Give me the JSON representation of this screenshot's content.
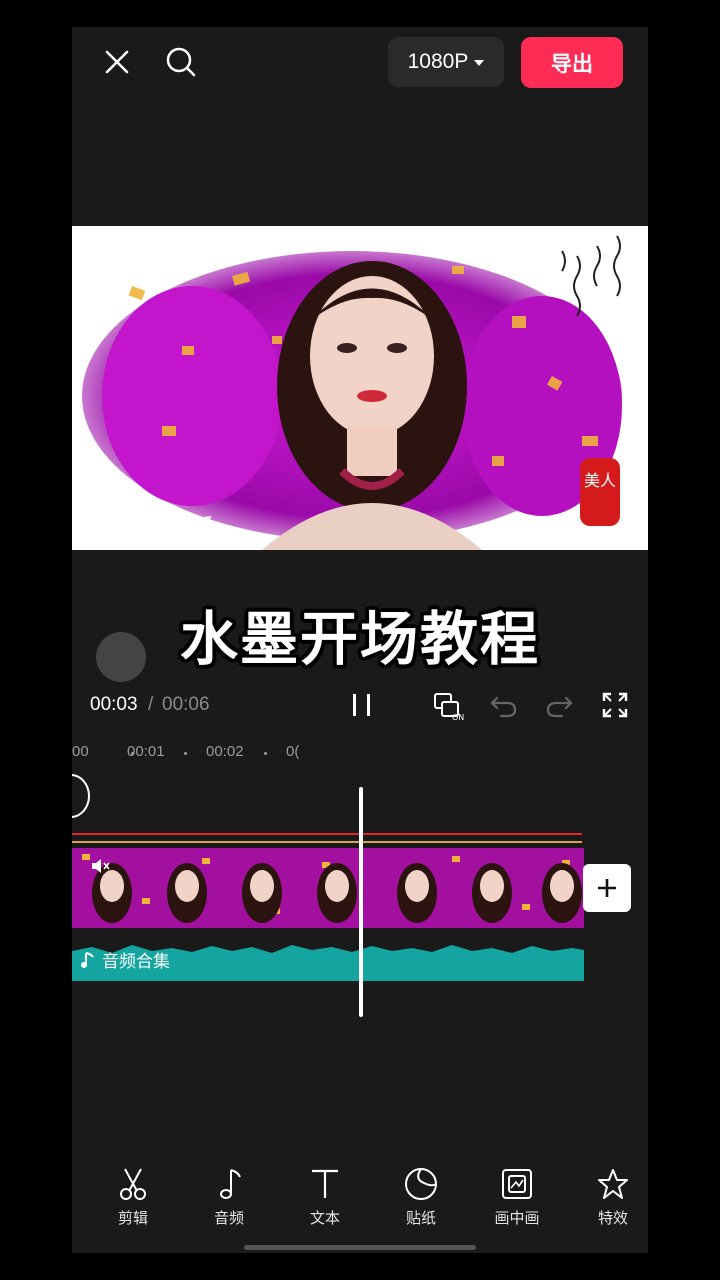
{
  "topbar": {
    "close_icon": "close-icon",
    "search_icon": "search-icon",
    "resolution": "1080P",
    "export_label": "导出"
  },
  "preview": {
    "overlay_title": "水墨开场教程",
    "seal_text": "美人"
  },
  "playback": {
    "current_time": "00:03",
    "separator": "/",
    "total_time": "00:06"
  },
  "ruler": {
    "labels": [
      "00",
      "00:01",
      "00:02",
      "0("
    ]
  },
  "audio": {
    "label": "音频合集"
  },
  "toolbar": {
    "items": [
      {
        "label": "剪辑",
        "icon": "scissors-icon"
      },
      {
        "label": "音频",
        "icon": "music-note-icon"
      },
      {
        "label": "文本",
        "icon": "text-icon"
      },
      {
        "label": "贴纸",
        "icon": "sticker-icon"
      },
      {
        "label": "画中画",
        "icon": "picture-in-picture-icon"
      },
      {
        "label": "特效",
        "icon": "effects-star-icon"
      }
    ]
  },
  "colors": {
    "accent": "#fe2c55",
    "audio_track": "#14a5a0",
    "background": "#1a1a1a"
  }
}
